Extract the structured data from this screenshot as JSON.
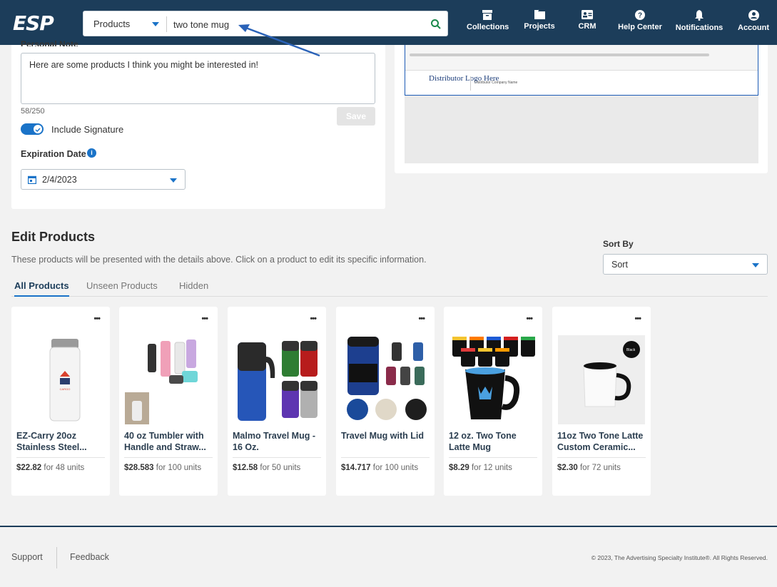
{
  "header": {
    "logo": "ESP",
    "search": {
      "type": "Products",
      "value": "two tone mug"
    },
    "nav": [
      {
        "label": "Collections"
      },
      {
        "label": "Projects"
      },
      {
        "label": "CRM"
      },
      {
        "label": "Help Center"
      },
      {
        "label": "Notifications"
      },
      {
        "label": "Account"
      }
    ]
  },
  "note": {
    "label": "Personal Note",
    "text": "Here are some products I think you might be interested in!",
    "counter": "58/250",
    "save_label": "Save"
  },
  "signature": {
    "label": "Include Signature",
    "on": true
  },
  "expiration": {
    "label": "Expiration Date",
    "value": "2/4/2023"
  },
  "preview": {
    "logo_text": "Distributor Logo Here",
    "company": "Distributor Company Name"
  },
  "edit_products": {
    "title": "Edit Products",
    "description": "These products will be presented with the details above. Click on a product to edit its specific information.",
    "sort_label": "Sort By",
    "sort_value": "Sort",
    "tabs": [
      "All Products",
      "Unseen Products",
      "Hidden"
    ],
    "products": [
      {
        "name": "EZ-Carry 20oz Stainless Steel...",
        "price": "$22.82",
        "qty": "for 48 units"
      },
      {
        "name": "40 oz Tumbler with Handle and Straw...",
        "price": "$28.583",
        "qty": "for 100 units"
      },
      {
        "name": "Malmo Travel Mug - 16 Oz.",
        "price": "$12.58",
        "qty": "for 50 units"
      },
      {
        "name": "Travel Mug with Lid",
        "price": "$14.717",
        "qty": "for 100 units"
      },
      {
        "name": "12 oz. Two Tone Latte Mug",
        "price": "$8.29",
        "qty": "for 12 units"
      },
      {
        "name": "11oz Two Tone Latte Custom Ceramic...",
        "price": "$2.30",
        "qty": "for 72 units",
        "badge": "Black"
      }
    ]
  },
  "footer": {
    "support": "Support",
    "feedback": "Feedback",
    "copyright": "© 2023, The Advertising Specialty Institute®. All Rights Reserved."
  },
  "colors": {
    "header": "#1c3d5a",
    "accent": "#1a73c8",
    "background": "#f2f2f2"
  }
}
